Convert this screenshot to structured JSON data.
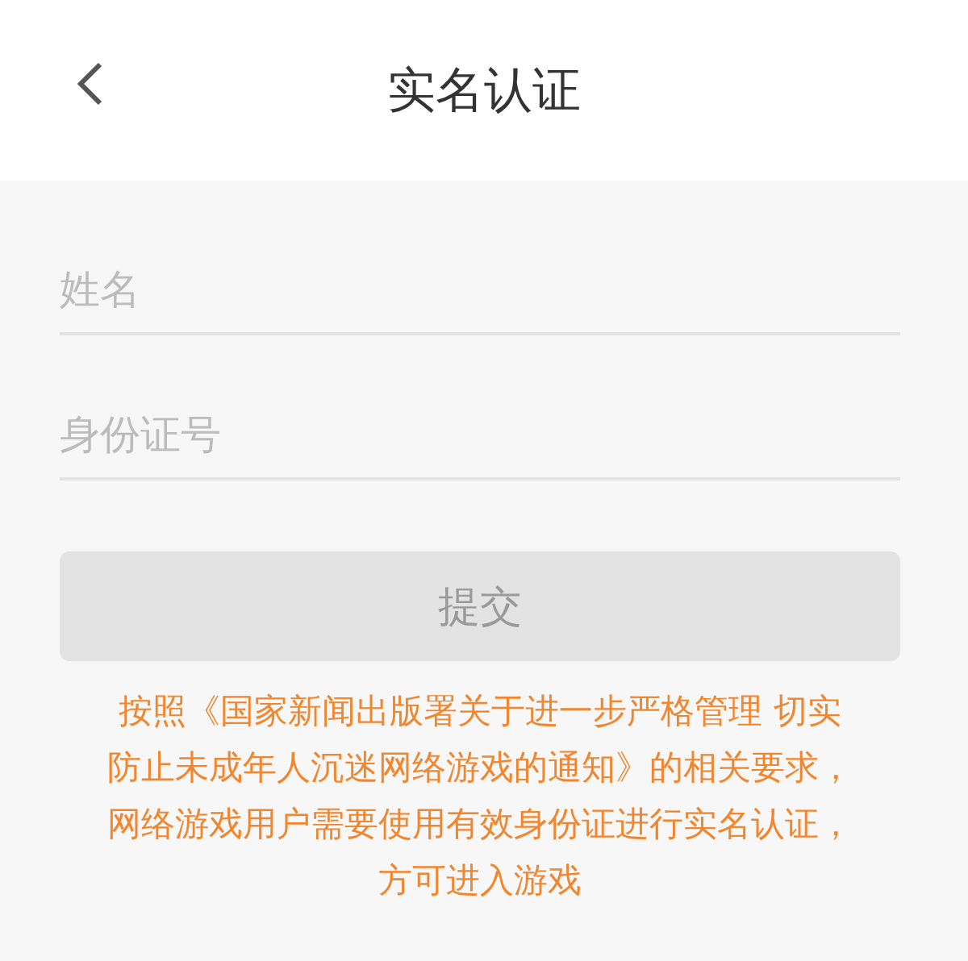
{
  "header": {
    "title": "实名认证"
  },
  "fields": [
    {
      "placeholder": "姓名"
    },
    {
      "placeholder": "身份证号"
    }
  ],
  "submit": {
    "label": "提交",
    "disabled": true
  },
  "notice": "按照《国家新闻出版署关于进一步严格管理 切实防止未成年人沉迷网络游戏的通知》的相关要求，网络游戏用户需要使用有效身份证进行实名认证，方可进入游戏"
}
